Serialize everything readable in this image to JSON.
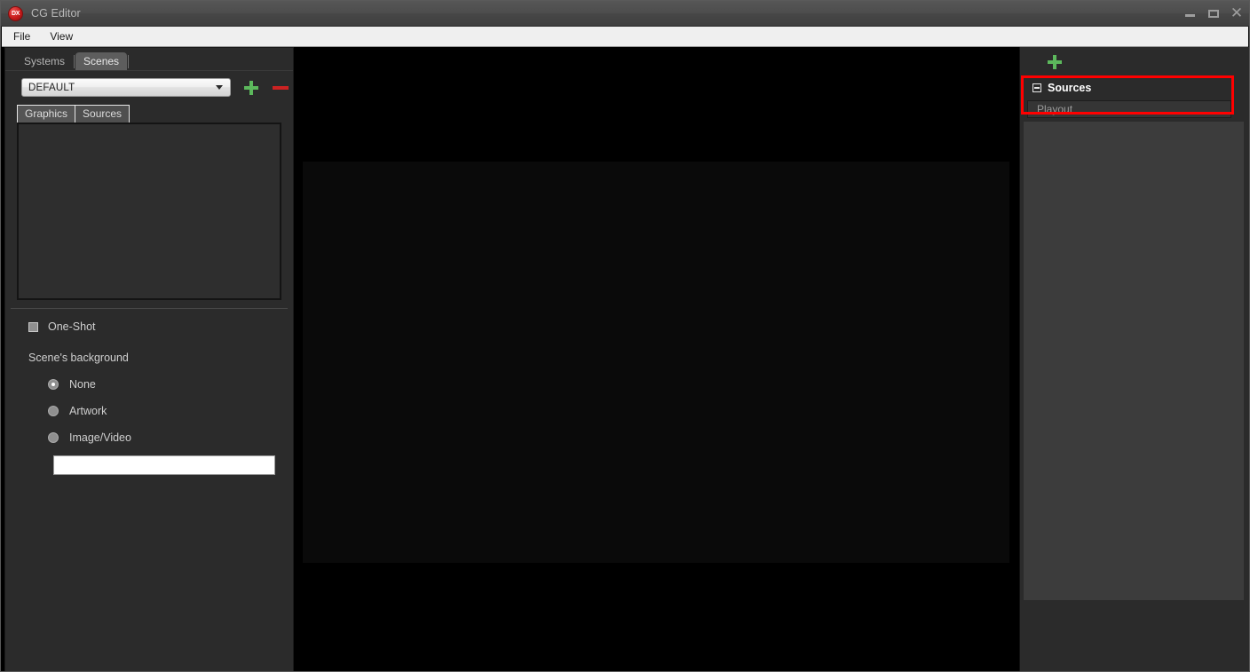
{
  "window": {
    "title": "CG Editor",
    "logo_text": "DX",
    "logo_icon": "app-logo-icon",
    "controls": {
      "minimize": "minimize-icon",
      "maximize": "maximize-icon",
      "close": "✕"
    }
  },
  "menubar": {
    "items": [
      {
        "label": "File"
      },
      {
        "label": "View"
      }
    ]
  },
  "left_panel": {
    "tabs": [
      {
        "label": "Systems",
        "active": false
      },
      {
        "label": "Scenes",
        "active": true
      }
    ],
    "scene_select": {
      "value": "DEFAULT",
      "options": [
        "DEFAULT"
      ],
      "caret_icon": "chevron-down-icon"
    },
    "add_button": {
      "icon": "plus-icon",
      "color": "#5cb85c"
    },
    "remove_button": {
      "icon": "minus-icon",
      "color": "#cc2222"
    },
    "subtabs": [
      {
        "label": "Graphics",
        "active": true
      },
      {
        "label": "Sources",
        "active": false
      }
    ],
    "graphics_list": {
      "items": []
    },
    "one_shot": {
      "label": "One-Shot",
      "checked": false
    },
    "background_section": {
      "label": "Scene's background",
      "options": [
        {
          "label": "None",
          "selected": true
        },
        {
          "label": "Artwork",
          "selected": false
        },
        {
          "label": "Image/Video",
          "selected": false
        }
      ],
      "path_value": "",
      "path_placeholder": ""
    }
  },
  "preview": {
    "name": "scene-preview"
  },
  "right_panel": {
    "add_button": {
      "icon": "plus-icon",
      "color": "#5cb85c"
    },
    "sources_group": {
      "title": "Sources",
      "collapse_icon": "collapse-minus-icon",
      "items": [
        {
          "label": "Playout"
        }
      ]
    },
    "highlight_color": "#ff0000"
  }
}
